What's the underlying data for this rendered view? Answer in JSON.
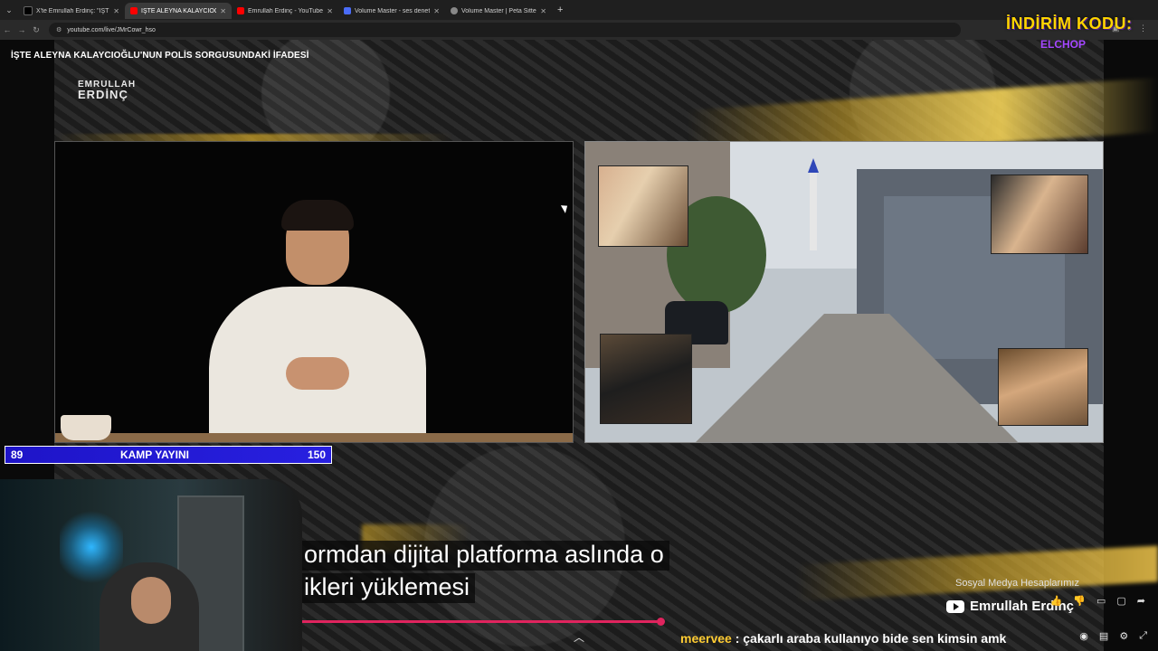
{
  "browser": {
    "tabs": [
      {
        "label": "X'te Emrullah Erdinç: \"İŞTE ALEYNA",
        "favicon_color": "#000000",
        "active": false
      },
      {
        "label": "İŞTE ALEYNA KALAYCIOĞLU",
        "favicon_color": "#ff0000",
        "active": true
      },
      {
        "label": "Emrullah Erdinç - YouTube",
        "favicon_color": "#ff0000",
        "active": false
      },
      {
        "label": "Volume Master - ses denetleyic",
        "favicon_color": "#4a6cf7",
        "active": false
      },
      {
        "label": "Volume Master | Peta Sittek",
        "favicon_color": "#888888",
        "active": false
      }
    ],
    "url": "youtube.com/live/JMrCowr_hso"
  },
  "video": {
    "title": "İŞTE ALEYNA KALAYCIOĞLU'NUN POLİS SORGUSUNDAKİ İFADESİ",
    "logo_line1": "EMRULLAH",
    "logo_line2": "ERDİNÇ",
    "promo_title": "İNDİRİM KODU:",
    "promo_code": "ELCHOP"
  },
  "statbar": {
    "left": "89",
    "center": "KAMP YAYINI",
    "right": "150",
    "color": "#2820e0"
  },
  "captions": {
    "line1": "ormdan dijital platforma aslında o",
    "line2": "ikleri yüklemesi"
  },
  "social": {
    "heading": "Sosyal Medya Hesaplarımız",
    "channel": "Emrullah Erdinç"
  },
  "chat": {
    "user": "meervee",
    "message": ": çakarlı araba kullanıyo bide sen kimsin amk"
  },
  "colors": {
    "accent_gold": "#d6aa28",
    "progress": "#e0245e",
    "promo_yellow": "#ffd500",
    "chat_user": "#ffcc33"
  }
}
